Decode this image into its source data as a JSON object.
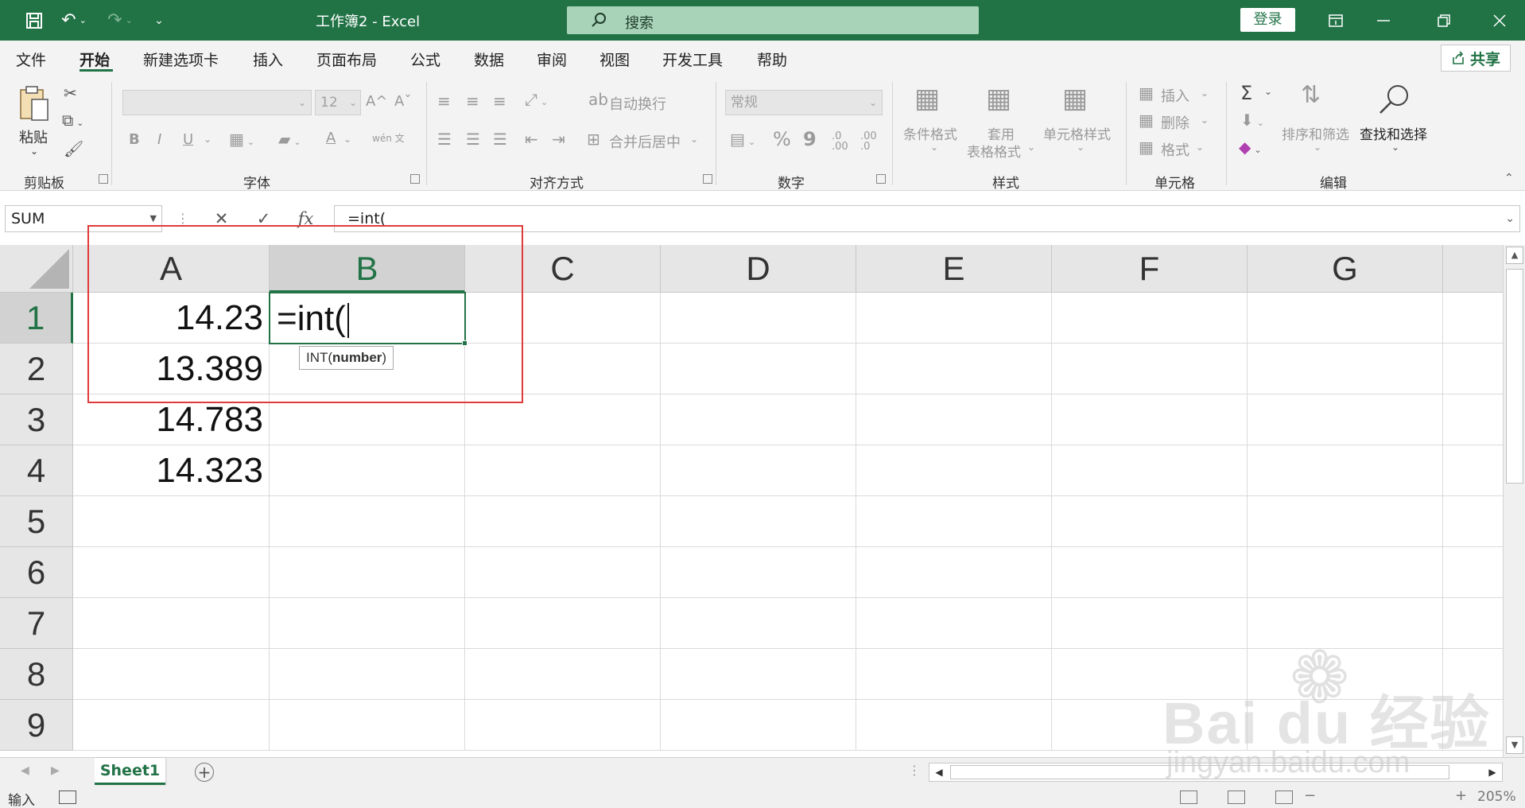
{
  "titlebar": {
    "doc_title": "工作簿2  -  Excel",
    "search_label": "搜索",
    "login_label": "登录"
  },
  "menu": {
    "tabs": [
      "文件",
      "开始",
      "新建选项卡",
      "插入",
      "页面布局",
      "公式",
      "数据",
      "审阅",
      "视图",
      "开发工具",
      "帮助"
    ],
    "active": "开始",
    "share_label": "共享"
  },
  "ribbon": {
    "clipboard": {
      "label": "剪贴板",
      "paste": "粘贴"
    },
    "font": {
      "label": "字体",
      "size": "12",
      "bold": "B",
      "italic": "I",
      "underline": "U",
      "grow": "A^",
      "shrink": "Aˇ",
      "font_color": "A",
      "phonetic": "wén 文"
    },
    "alignment": {
      "label": "对齐方式",
      "wrap": "自动换行",
      "merge": "合并后居中"
    },
    "number": {
      "label": "数字",
      "format": "常规",
      "percent": "%",
      "comma": "9"
    },
    "styles": {
      "label": "样式",
      "conditional": "条件格式",
      "table": "套用\n表格格式",
      "table_l1": "套用",
      "table_l2": "表格格式",
      "cell_styles": "单元格样式"
    },
    "cells": {
      "label": "单元格",
      "insert": "插入",
      "delete": "删除",
      "format": "格式"
    },
    "editing": {
      "label": "编辑",
      "sum": "Σ",
      "sort": "排序和筛选",
      "find": "查找和选择"
    }
  },
  "formula_bar": {
    "name_box": "SUM",
    "cancel": "✕",
    "enter": "✓",
    "fx": "fx",
    "formula": "=int("
  },
  "grid": {
    "columns": [
      "A",
      "B",
      "C",
      "D",
      "E",
      "F",
      "G"
    ],
    "selected_column": "B",
    "rows": [
      "1",
      "2",
      "3",
      "4",
      "5",
      "6",
      "7",
      "8",
      "9"
    ],
    "selected_row": "1",
    "cells": {
      "A1": "14.23",
      "A2": "13.389",
      "A3": "14.783",
      "A4": "14.323",
      "B1": "=int("
    },
    "tooltip": {
      "fn": "INT(",
      "arg": "number",
      "close": ")"
    }
  },
  "sheets": {
    "tabs": [
      "Sheet1"
    ],
    "active": "Sheet1",
    "add": "+"
  },
  "status": {
    "mode": "输入",
    "zoom": "205%"
  },
  "watermark": {
    "brand": "Bai du 经验",
    "url": "jingyan.baidu.com"
  },
  "colors": {
    "accent": "#217346",
    "highlight_box": "#e03b3b"
  }
}
